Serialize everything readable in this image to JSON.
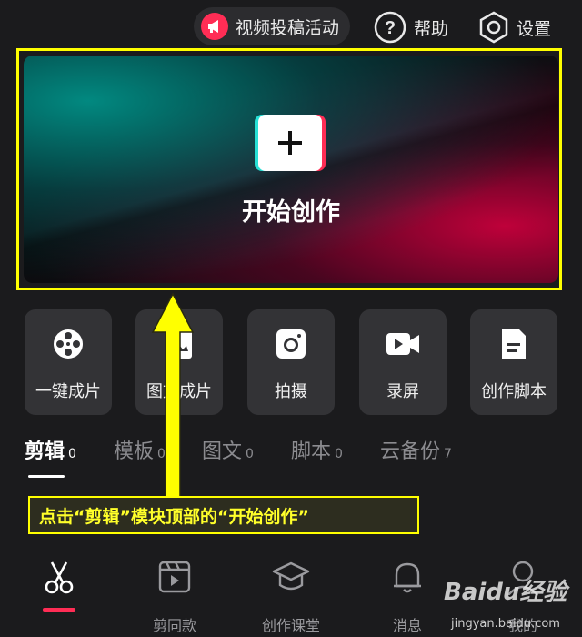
{
  "topbar": {
    "promo_label": "视频投稿活动",
    "help_label": "帮助",
    "settings_label": "设置"
  },
  "create": {
    "title": "开始创作"
  },
  "tools": [
    {
      "label": "一键成片",
      "icon": "film-reel-icon"
    },
    {
      "label": "图文成片",
      "icon": "image-text-icon"
    },
    {
      "label": "拍摄",
      "icon": "camera-icon"
    },
    {
      "label": "录屏",
      "icon": "video-record-icon"
    },
    {
      "label": "创作脚本",
      "icon": "script-doc-icon"
    }
  ],
  "tabs": [
    {
      "name": "剪辑",
      "count": "0",
      "active": true
    },
    {
      "name": "模板",
      "count": "0",
      "active": false
    },
    {
      "name": "图文",
      "count": "0",
      "active": false
    },
    {
      "name": "脚本",
      "count": "0",
      "active": false
    },
    {
      "name": "云备份",
      "count": "7",
      "active": false
    }
  ],
  "annotation": {
    "callout_text": "点击“剪辑”模块顶部的“开始创作”",
    "color": "#ffff00"
  },
  "bottom_nav": [
    {
      "label": "",
      "icon": "scissors-icon",
      "active": true
    },
    {
      "label": "剪同款",
      "icon": "clapperboard-icon",
      "active": false
    },
    {
      "label": "创作课堂",
      "icon": "graduation-cap-icon",
      "active": false
    },
    {
      "label": "消息",
      "icon": "bell-icon",
      "active": false
    },
    {
      "label": "我的",
      "icon": "profile-icon",
      "active": false
    }
  ],
  "watermark": {
    "brand": "Baidu经验",
    "url": "jingyan.baidu.com"
  },
  "colors": {
    "accent": "#ff2d55",
    "teal": "#27e0d6",
    "background": "#1b1b1d",
    "annotation": "#ffff00"
  }
}
